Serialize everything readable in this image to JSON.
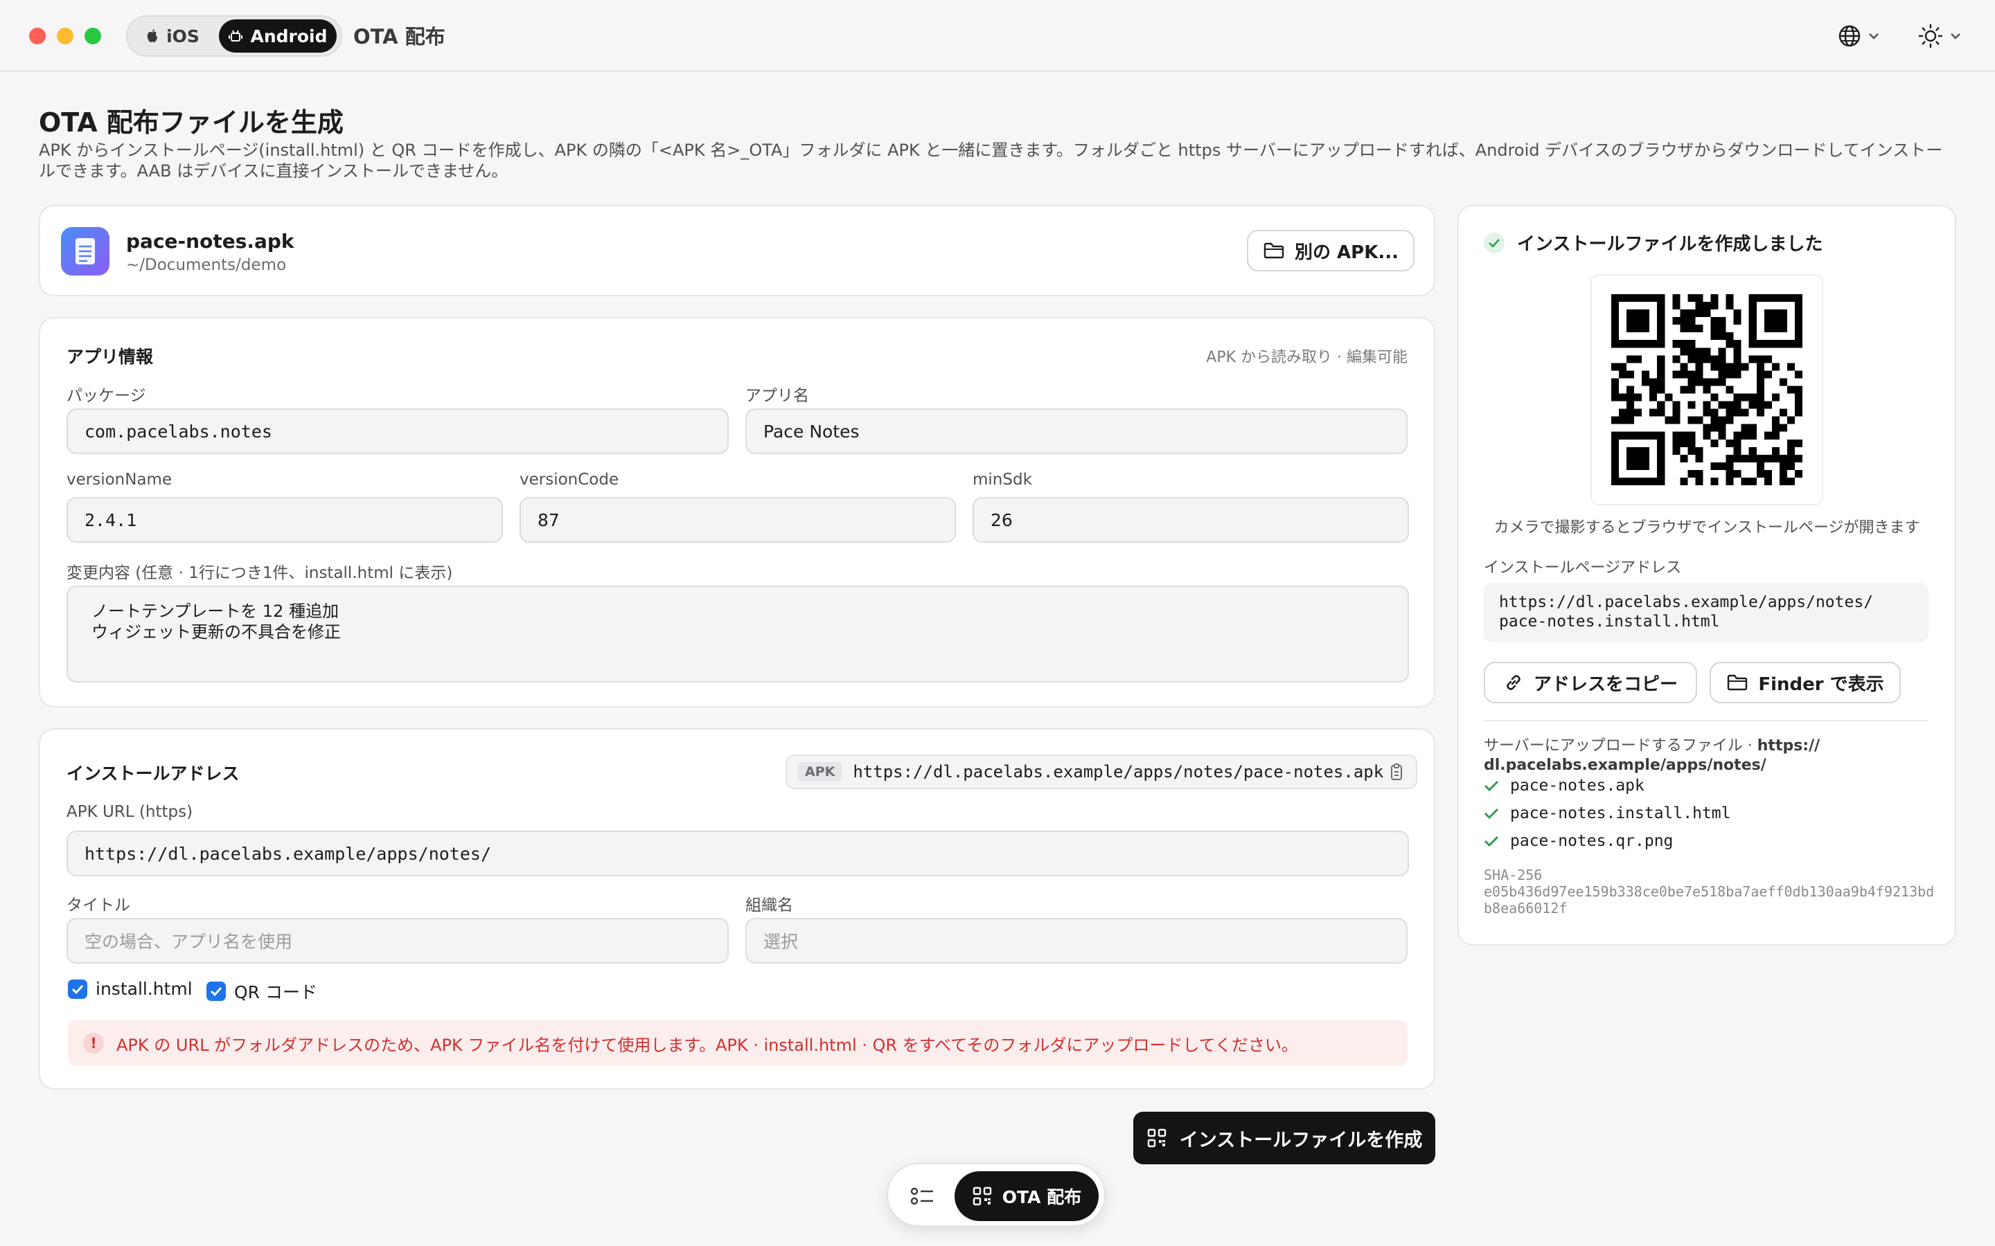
{
  "titlebar": {
    "platforms": [
      {
        "label": "iOS",
        "selected": false
      },
      {
        "label": "Android",
        "selected": true
      }
    ],
    "app_title": "OTA 配布"
  },
  "header": {
    "title": "OTA 配布ファイルを生成",
    "description": "APK からインストールページ(install.html) と QR コードを作成し、APK の隣の「<APK 名>_OTA」フォルダに APK と一緒に置きます。フォルダごと https サーバーにアップロードすれば、Android デバイスのブラウザからダウンロードしてインストールできます。AAB はデバイスに直接インストールできません。"
  },
  "file": {
    "name": "pace-notes.apk",
    "path": "~/Documents/demo",
    "other_button": "別の APK..."
  },
  "app_info": {
    "title": "アプリ情報",
    "note": "APK から読み取り · 編集可能",
    "package_label": "パッケージ",
    "package_value": "com.pacelabs.notes",
    "app_name_label": "アプリ名",
    "app_name_value": "Pace Notes",
    "version_name_label": "versionName",
    "version_name_value": "2.4.1",
    "version_code_label": "versionCode",
    "version_code_value": "87",
    "min_sdk_label": "minSdk",
    "min_sdk_value": "26",
    "changes_label": "変更内容 (任意 · 1行につき1件、install.html に表示)",
    "changes_lines": [
      "ノートテンプレートを 12 種追加",
      "ウィジェット更新の不具合を修正"
    ]
  },
  "install_address": {
    "title": "インストールアドレス",
    "apk_tag": "APK",
    "apk_full_url": "https://dl.pacelabs.example/apps/notes/pace-notes.apk",
    "apk_url_label": "APK URL (https)",
    "apk_url_value": "https://dl.pacelabs.example/apps/notes/",
    "title_label": "タイトル",
    "title_placeholder": "空の場合、アプリ名を使用",
    "org_label": "組織名",
    "org_placeholder": "選択",
    "check_install_html": "install.html",
    "check_qr": "QR コード",
    "warning": "APK の URL がフォルダアドレスのため、APK ファイル名を付けて使用します。APK · install.html · QR をすべてそのフォルダにアップロードしてください。"
  },
  "result": {
    "heading": "インストールファイルを作成しました",
    "qr_caption": "カメラで撮影するとブラウザでインストールページが開きます",
    "page_address_label": "インストールページアドレス",
    "page_address_line1": "https://dl.pacelabs.example/apps/notes/",
    "page_address_line2": "pace-notes.install.html",
    "copy_button": "アドレスをコピー",
    "finder_button": "Finder で表示",
    "upload_prefix": "サーバーにアップロードするファイル · ",
    "upload_url_line1": "https://",
    "upload_url_line2": "dl.pacelabs.example/apps/notes/",
    "files": [
      "pace-notes.apk",
      "pace-notes.install.html",
      "pace-notes.qr.png"
    ],
    "sha_label": "SHA-256",
    "sha_value": "e05b436d97ee159b338ce0be7e518ba7aeff0db130aa9b4f9213bdb8ea66012f"
  },
  "actions": {
    "generate": "インストールファイルを作成"
  },
  "dock": {
    "ota_label": "OTA 配布"
  },
  "colors": {
    "accent": "#1f73e8",
    "primary_dark": "#141416",
    "success": "#2f9e4f",
    "warning": "#d3302f"
  }
}
